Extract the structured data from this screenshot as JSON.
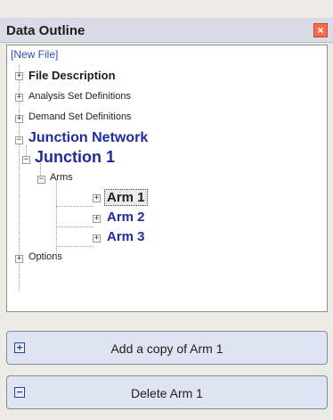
{
  "window": {
    "title": "Data Outline",
    "close_label": "×"
  },
  "tree": {
    "root": "[New File]",
    "items": [
      {
        "label": "File Description"
      },
      {
        "label": "Analysis Set Definitions"
      },
      {
        "label": "Demand Set Definitions"
      },
      {
        "label": "Junction Network"
      },
      {
        "label": "Junction 1"
      },
      {
        "label": "Arms"
      },
      {
        "label": "Arm 1"
      },
      {
        "label": "Arm 2"
      },
      {
        "label": "Arm 3"
      },
      {
        "label": "Options"
      }
    ],
    "expand_symbol": "+",
    "collapse_symbol": "−"
  },
  "actions": {
    "add_label": "Add a copy of Arm 1",
    "add_icon": "+",
    "delete_label": "Delete Arm 1",
    "delete_icon": "−"
  },
  "colors": {
    "accent_blue": "#1f2b9e",
    "close_red": "#f0714a"
  }
}
